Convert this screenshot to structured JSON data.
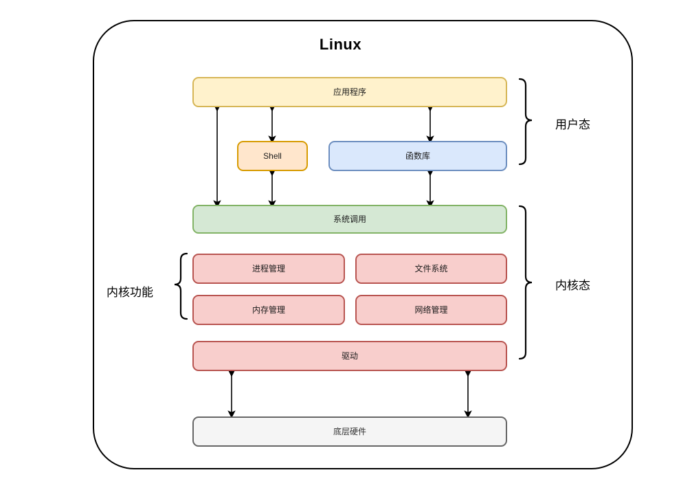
{
  "diagram": {
    "title": "Linux",
    "nodes": {
      "application": "应用程序",
      "shell": "Shell",
      "library": "函数库",
      "syscall": "系统调用",
      "process_mgmt": "进程管理",
      "file_system": "文件系统",
      "memory_mgmt": "内存管理",
      "network_mgmt": "网络管理",
      "driver": "驱动",
      "hardware": "底层硬件"
    },
    "labels": {
      "user_mode": "用户态",
      "kernel_mode": "内核态",
      "kernel_functions": "内核功能"
    },
    "colors": {
      "application_fill": "#fff2cc",
      "application_stroke": "#d6b656",
      "shell_fill": "#ffe6cc",
      "shell_stroke": "#d79b00",
      "library_fill": "#dae8fc",
      "library_stroke": "#6c8ebf",
      "syscall_fill": "#d5e8d4",
      "syscall_stroke": "#82b366",
      "kernel_fill": "#f8cecc",
      "kernel_stroke": "#b85450",
      "hardware_fill": "#f5f5f5",
      "hardware_stroke": "#666666",
      "outline": "#000000"
    }
  }
}
